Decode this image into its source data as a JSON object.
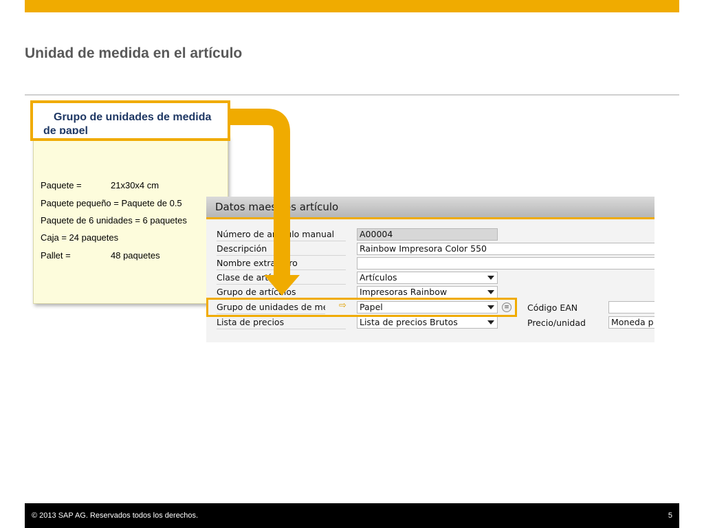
{
  "slide": {
    "title": "Unidad de medida en el artículo",
    "page_number": "5",
    "copyright": "©  2013 SAP AG. Reservados todos los derechos."
  },
  "note": {
    "header": "Grupo de unidades de medida de papel",
    "rows": [
      {
        "label": "Paquete =",
        "value": "21x30x4 cm"
      },
      {
        "label": "Paquete pequeño = Paquete de 0.5",
        "value": ""
      },
      {
        "label": "Paquete de 6 unidades = 6 paquetes",
        "value": ""
      },
      {
        "label": "Caja = 24 paquetes",
        "value": ""
      },
      {
        "label": "Pallet =",
        "value": "48 paquetes"
      }
    ]
  },
  "sap_window": {
    "title": "Datos maestros artículo",
    "fields": [
      {
        "label": "Número de artículo manual",
        "value": "A00004"
      },
      {
        "label": "Descripción",
        "value": "Rainbow Impresora Color 550"
      },
      {
        "label": "Nombre extranjero",
        "value": ""
      },
      {
        "label": "Clase de artículo",
        "value": "Artículos"
      },
      {
        "label": "Grupo de artículos",
        "value": "Impresoras Rainbow"
      },
      {
        "label": "Grupo de unidades de medida",
        "value": "Papel"
      },
      {
        "label": "Lista de precios",
        "value": "Lista de precios Brutos"
      }
    ],
    "right_fields": [
      {
        "label": "Código EAN",
        "value": ""
      },
      {
        "label": "Precio/unidad",
        "value": "Moneda p"
      }
    ]
  },
  "colors": {
    "accent": "#f0ab00",
    "note_bg": "#fdfcdc",
    "header_text": "#1f3864"
  }
}
